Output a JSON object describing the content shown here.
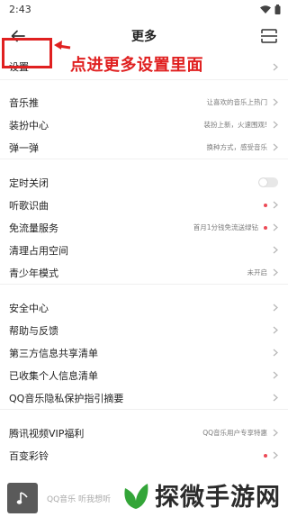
{
  "status_bar": {
    "time": "2:43"
  },
  "header": {
    "title": "更多"
  },
  "colors": {
    "accent_red": "#e02020",
    "dot_red": "#ec4a56"
  },
  "sections": [
    {
      "rows": [
        {
          "label": "设置"
        }
      ]
    },
    {
      "rows": [
        {
          "label": "音乐推",
          "desc": "让喜欢的音乐上热门",
          "dot": false
        },
        {
          "label": "装扮中心",
          "desc": "装扮上新，火速围观!",
          "dot": false
        },
        {
          "label": "弹一弹",
          "desc": "换种方式，感受音乐",
          "dot": false
        }
      ]
    },
    {
      "rows": [
        {
          "label": "定时关闭",
          "toggle": "off"
        },
        {
          "label": "听歌识曲",
          "dot": true
        },
        {
          "label": "免流量服务",
          "desc": "首月1分钱免流送绿钻",
          "dot": true
        },
        {
          "label": "清理占用空间"
        },
        {
          "label": "青少年模式",
          "desc": "未开启"
        }
      ]
    },
    {
      "rows": [
        {
          "label": "安全中心"
        },
        {
          "label": "帮助与反馈"
        },
        {
          "label": "第三方信息共享清单"
        },
        {
          "label": "已收集个人信息清单"
        },
        {
          "label": "QQ音乐隐私保护指引摘要"
        }
      ]
    },
    {
      "rows": [
        {
          "label": "腾讯视频VIP福利",
          "desc": "QQ音乐用户专享特惠"
        },
        {
          "label": "百变彩铃",
          "dot": true
        }
      ]
    }
  ],
  "annotation": {
    "text": "点进更多设置里面"
  },
  "player": {
    "text": "QQ音乐 听我想听"
  },
  "watermark": {
    "text": "探微手游网"
  },
  "icons": [
    "back-arrow-icon",
    "scan-icon",
    "chevron-right-icon",
    "music-note-icon",
    "watermark-logo-icon",
    "wifi-icon",
    "battery-icon"
  ]
}
